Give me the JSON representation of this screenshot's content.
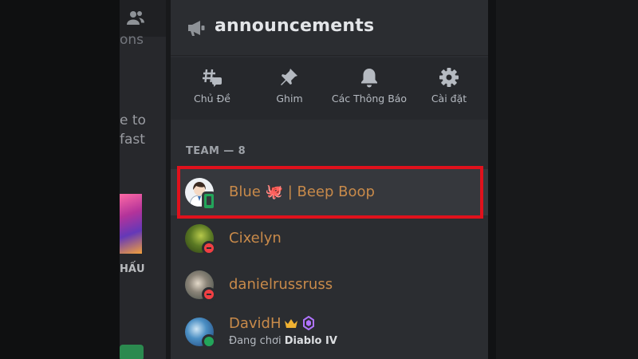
{
  "background": {
    "partial_texts": [
      "ons",
      "e to",
      "fast",
      "HẤU"
    ],
    "icons": [
      "friends-icon"
    ]
  },
  "channel": {
    "icon": "megaphone-icon",
    "title": "announcements"
  },
  "toolbar": {
    "items": [
      {
        "label": "Chủ Đề",
        "icon": "threads-icon"
      },
      {
        "label": "Ghim",
        "icon": "pin-icon"
      },
      {
        "label": "Các Thông Báo",
        "icon": "bell-icon"
      },
      {
        "label": "Cài đặt",
        "icon": "gear-icon"
      }
    ]
  },
  "members": {
    "section_label": "TEAM — 8",
    "list": [
      {
        "name": "Blue 🐙 | Beep Boop",
        "status": "online-mobile",
        "selected": true
      },
      {
        "name": "Cixelyn",
        "status": "do-not-disturb"
      },
      {
        "name": "danielrussruss",
        "status": "do-not-disturb"
      },
      {
        "name": "DavidH",
        "status": "online",
        "activity_prefix": "Đang chơi",
        "activity_game": "Diablo IV",
        "badges": [
          "crown-icon",
          "boost-icon"
        ]
      }
    ]
  },
  "colors": {
    "name_color": "#c88a4a",
    "selection_border": "#e0111c",
    "online": "#23a55a",
    "dnd": "#f23f43"
  }
}
